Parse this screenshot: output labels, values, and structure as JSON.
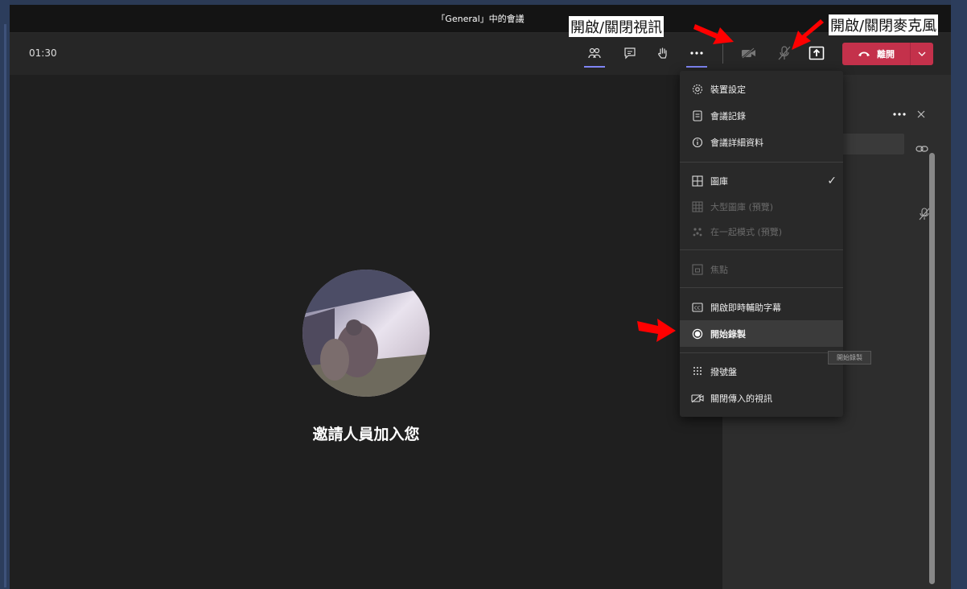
{
  "window": {
    "title": "「General」中的會議"
  },
  "toolbar": {
    "timer": "01:30",
    "leave_label": "離開"
  },
  "stage": {
    "invite_text": "邀請人員加入您"
  },
  "menu": {
    "items": [
      {
        "label": "裝置設定",
        "icon": "gear-icon",
        "enabled": true
      },
      {
        "label": "會議記錄",
        "icon": "notes-icon",
        "enabled": true
      },
      {
        "label": "會議詳細資料",
        "icon": "info-icon",
        "enabled": true
      },
      {
        "label": "圖庫",
        "icon": "gallery-icon",
        "enabled": true,
        "checked": true
      },
      {
        "label": "大型圖庫 (預覽)",
        "icon": "large-gallery-icon",
        "enabled": false
      },
      {
        "label": "在一起模式 (預覽)",
        "icon": "together-mode-icon",
        "enabled": false
      },
      {
        "label": "焦點",
        "icon": "focus-icon",
        "enabled": false
      },
      {
        "label": "開啟即時輔助字幕",
        "icon": "captions-icon",
        "enabled": true
      },
      {
        "label": "開始錄製",
        "icon": "record-icon",
        "enabled": true,
        "highlighted": true
      },
      {
        "label": "撥號盤",
        "icon": "dialpad-icon",
        "enabled": true
      },
      {
        "label": "關閉傳入的視訊",
        "icon": "video-off-icon",
        "enabled": true
      }
    ]
  },
  "tooltip": {
    "text": "開始錄製"
  },
  "annotations": {
    "video_toggle": "開啟/關閉視訊",
    "mic_toggle": "開啟/關閉麥克風"
  },
  "colors": {
    "leave": "#c4314b",
    "accent": "#7f85f5",
    "arrow": "#ff0000"
  }
}
